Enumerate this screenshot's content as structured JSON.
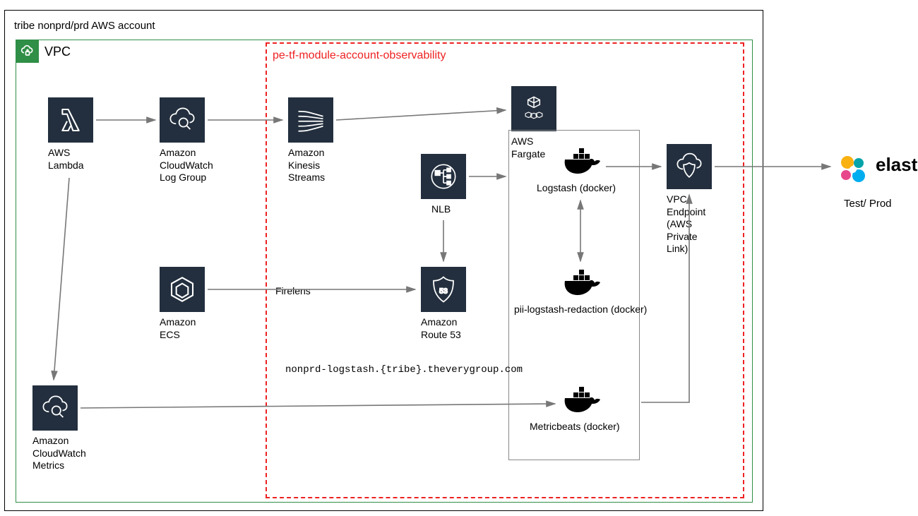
{
  "account_label": "tribe nonprd/prd AWS account",
  "vpc_label": "VPC",
  "observability_label": "pe-tf-module-account-observability",
  "nodes": {
    "lambda": "AWS\nLambda",
    "cw_log_group": "Amazon\nCloudWatch\nLog Group",
    "kinesis": "Amazon\nKinesis\nStreams",
    "ecs": "Amazon\nECS",
    "nlb": "NLB",
    "route53": "Amazon\nRoute 53",
    "fargate": "AWS\nFargate",
    "logstash": "Logstash (docker)",
    "pii": "pii-logstash-redaction (docker)",
    "metricbeats": "Metricbeats (docker)",
    "cw_metrics": "Amazon\nCloudWatch\nMetrics",
    "vpc_endpoint": "VPC\nEndpoint\n(AWS\nPrivate\nLink)",
    "firelens": "Firelens",
    "domain": "nonprd-logstash.{tribe}.theverygroup.com"
  },
  "elastic": {
    "name": "elastic",
    "env": "Test/ Prod"
  }
}
